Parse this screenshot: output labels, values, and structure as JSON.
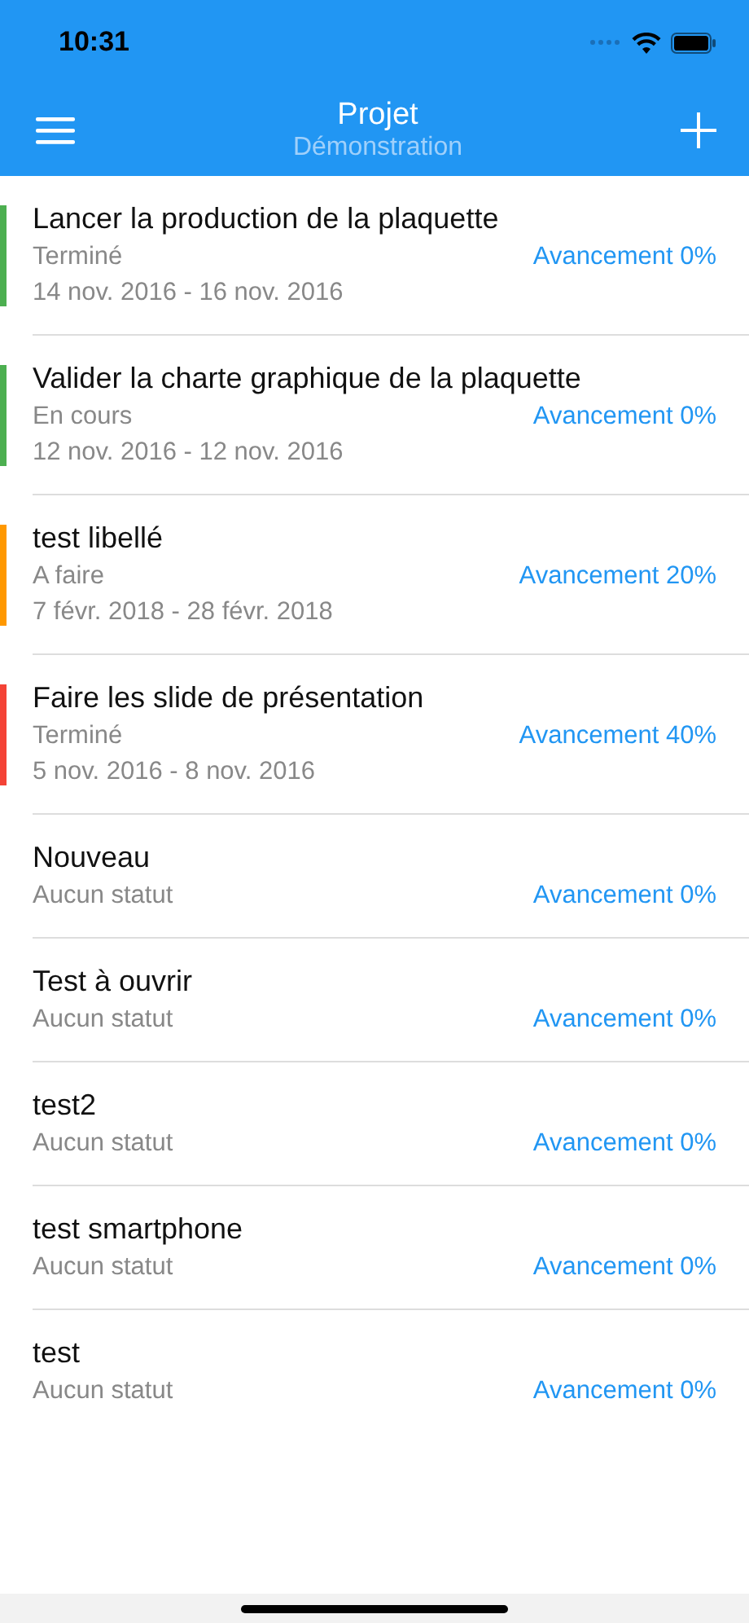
{
  "status_bar": {
    "time": "10:31"
  },
  "nav": {
    "title": "Projet",
    "subtitle": "Démonstration"
  },
  "tasks": [
    {
      "title": "Lancer la production de la plaquette",
      "status": "Terminé",
      "dates": "14 nov. 2016 - 16 nov. 2016",
      "progress": "Avancement 0%",
      "color": "#4caf50"
    },
    {
      "title": "Valider la charte graphique de la plaquette",
      "status": "En cours",
      "dates": "12 nov. 2016 - 12 nov. 2016",
      "progress": "Avancement 0%",
      "color": "#4caf50"
    },
    {
      "title": "test libellé",
      "status": "A faire",
      "dates": "7 févr. 2018 - 28 févr. 2018",
      "progress": "Avancement 20%",
      "color": "#ff9800"
    },
    {
      "title": "Faire les slide de présentation",
      "status": "Terminé",
      "dates": "5 nov. 2016 - 8 nov. 2016",
      "progress": "Avancement 40%",
      "color": "#f44336"
    },
    {
      "title": "Nouveau",
      "status": "Aucun statut",
      "progress": "Avancement 0%"
    },
    {
      "title": "Test à ouvrir",
      "status": "Aucun statut",
      "progress": "Avancement 0%"
    },
    {
      "title": "test2",
      "status": "Aucun statut",
      "progress": "Avancement 0%"
    },
    {
      "title": "test smartphone",
      "status": "Aucun statut",
      "progress": "Avancement 0%"
    },
    {
      "title": "test",
      "status": "Aucun statut",
      "progress": "Avancement 0%"
    }
  ]
}
